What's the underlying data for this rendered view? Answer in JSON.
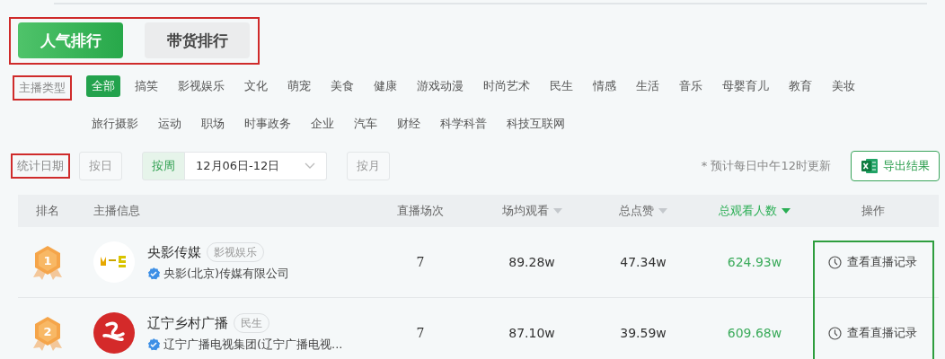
{
  "ranking_tabs": [
    {
      "label": "人气排行",
      "selected": true
    },
    {
      "label": "带货排行",
      "selected": false
    }
  ],
  "category_filter": {
    "label": "主播类型",
    "options": [
      {
        "label": "全部",
        "selected": true
      },
      {
        "label": "搞笑",
        "selected": false
      },
      {
        "label": "影视娱乐",
        "selected": false
      },
      {
        "label": "文化",
        "selected": false
      },
      {
        "label": "萌宠",
        "selected": false
      },
      {
        "label": "美食",
        "selected": false
      },
      {
        "label": "健康",
        "selected": false
      },
      {
        "label": "游戏动漫",
        "selected": false
      },
      {
        "label": "时尚艺术",
        "selected": false
      },
      {
        "label": "民生",
        "selected": false
      },
      {
        "label": "情感",
        "selected": false
      },
      {
        "label": "生活",
        "selected": false
      },
      {
        "label": "音乐",
        "selected": false
      },
      {
        "label": "母婴育儿",
        "selected": false
      },
      {
        "label": "教育",
        "selected": false
      },
      {
        "label": "美妆",
        "selected": false
      },
      {
        "label": "旅行摄影",
        "selected": false
      },
      {
        "label": "运动",
        "selected": false
      },
      {
        "label": "职场",
        "selected": false
      },
      {
        "label": "时事政务",
        "selected": false
      },
      {
        "label": "企业",
        "selected": false
      },
      {
        "label": "汽车",
        "selected": false
      },
      {
        "label": "财经",
        "selected": false
      },
      {
        "label": "科学科普",
        "selected": false
      },
      {
        "label": "科技互联网",
        "selected": false
      }
    ]
  },
  "date_filter": {
    "label": "统计日期",
    "options": [
      {
        "label": "按日",
        "selected": false
      },
      {
        "label": "按周",
        "selected": true,
        "value": "12月06日-12日"
      },
      {
        "label": "按月",
        "selected": false
      }
    ],
    "note": "* 预计每日中午12时更新",
    "export_button": "导出结果"
  },
  "table": {
    "columns": [
      {
        "label": "排名",
        "kind": "plain",
        "selected": false
      },
      {
        "label": "主播信息",
        "kind": "plain",
        "selected": false
      },
      {
        "label": "直播场次",
        "kind": "plain",
        "selected": false
      },
      {
        "label": "场均观看",
        "kind": "sortable",
        "selected": false
      },
      {
        "label": "总点赞",
        "kind": "sortable",
        "selected": false
      },
      {
        "label": "总观看人数",
        "kind": "sortable",
        "selected": true
      },
      {
        "label": "操作",
        "kind": "plain",
        "selected": false
      }
    ],
    "rows": [
      {
        "rank": "1",
        "name": "央影传媒",
        "tag": "影视娱乐",
        "company": "央影(北京)传媒有限公司",
        "verified": true,
        "sessions": "7",
        "avg_views": "89.28w",
        "likes": "47.34w",
        "total_viewers": "624.93w",
        "action": "查看直播记录"
      },
      {
        "rank": "2",
        "name": "辽宁乡村广播",
        "tag": "民生",
        "company": "辽宁广播电视集团(辽宁广播电视...",
        "verified": true,
        "sessions": "7",
        "avg_views": "87.10w",
        "likes": "39.59w",
        "total_viewers": "609.68w",
        "action": "查看直播记录"
      }
    ]
  }
}
